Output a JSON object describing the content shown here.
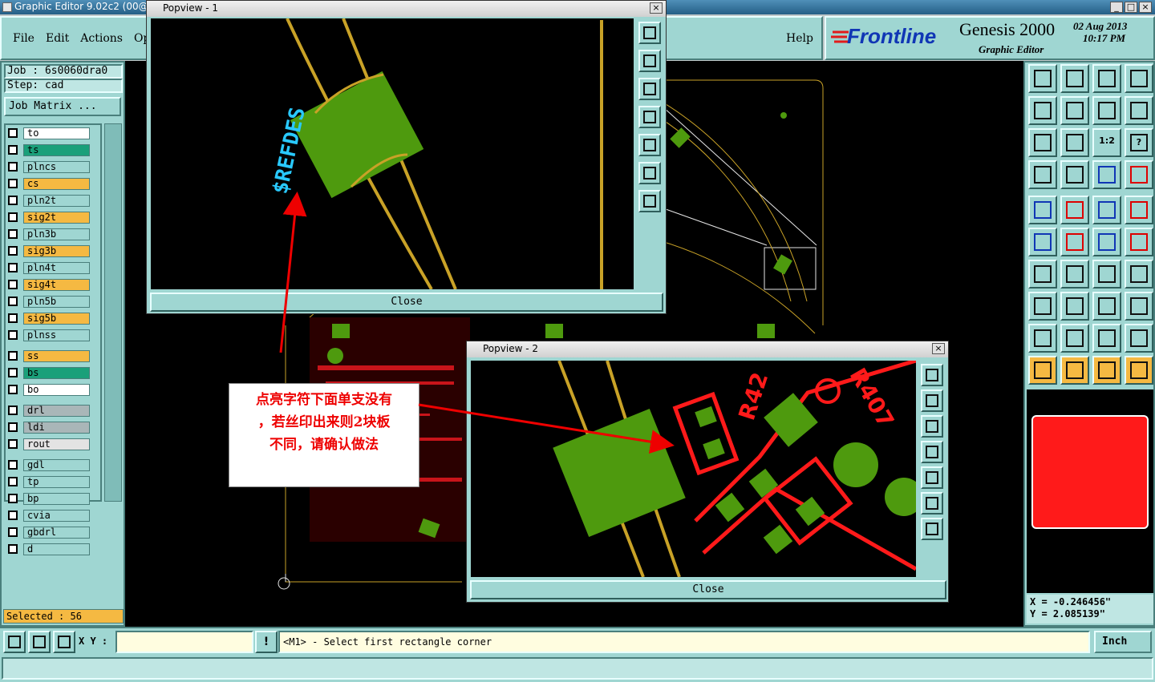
{
  "app": {
    "title": "Graphic Editor 9.02c2 (00@H)",
    "win_buttons": [
      "_",
      "□",
      "×"
    ]
  },
  "menu": [
    "File",
    "Edit",
    "Actions",
    "Op"
  ],
  "help": "Help",
  "brand": {
    "logo": "Frontline",
    "product": "Genesis 2000",
    "subtitle": "Graphic Editor",
    "date": "02 Aug 2013",
    "time": "10:17 PM"
  },
  "job": {
    "job": "Job : 6s0060dra0",
    "step": "Step: cad",
    "matrix_btn": "Job Matrix ..."
  },
  "layers": [
    {
      "name": "to",
      "color": "#ffffff"
    },
    {
      "name": "ts",
      "color": "#1aa07a"
    },
    {
      "name": "plncs",
      "color": "#9fd6d2"
    },
    {
      "name": "cs",
      "color": "#f5b942"
    },
    {
      "name": "pln2t",
      "color": "#9fd6d2"
    },
    {
      "name": "sig2t",
      "color": "#f5b942"
    },
    {
      "name": "pln3b",
      "color": "#9fd6d2"
    },
    {
      "name": "sig3b",
      "color": "#f5b942"
    },
    {
      "name": "pln4t",
      "color": "#9fd6d2"
    },
    {
      "name": "sig4t",
      "color": "#f5b942"
    },
    {
      "name": "pln5b",
      "color": "#9fd6d2"
    },
    {
      "name": "sig5b",
      "color": "#f5b942"
    },
    {
      "name": "plnss",
      "color": "#9fd6d2"
    },
    {
      "name": "ss",
      "color": "#f5b942"
    },
    {
      "name": "bs",
      "color": "#1aa07a"
    },
    {
      "name": "bo",
      "color": "#ffffff"
    },
    {
      "name": "drl",
      "color": "#a9b6b8"
    },
    {
      "name": "ldi",
      "color": "#a9b6b8"
    },
    {
      "name": "rout",
      "color": "#e3e3e3"
    },
    {
      "name": "gdl",
      "color": "#9fd6d2"
    },
    {
      "name": "tp",
      "color": "#9fd6d2"
    },
    {
      "name": "bp",
      "color": "#9fd6d2"
    },
    {
      "name": "cvia",
      "color": "#9fd6d2"
    },
    {
      "name": "gbdrl",
      "color": "#9fd6d2"
    },
    {
      "name": "d",
      "color": "#9fd6d2"
    }
  ],
  "selected": "Selected : 56",
  "popview1": {
    "title": "Popview - 1",
    "close": "Close",
    "refdes": "$REFDES"
  },
  "popview2": {
    "title": "Popview - 2",
    "close": "Close",
    "labels": [
      "R42",
      "R407"
    ]
  },
  "annotation": {
    "line1": "点亮字符下面单支没有",
    "line2": "，若丝印出来则2块板",
    "line3": "不同，请确认做法"
  },
  "coords": {
    "x": "X = -0.246456\"",
    "y": "Y = 2.085139\""
  },
  "bottom": {
    "xy_label": "X Y :",
    "xy_value": "",
    "prompt": "<M1> - Select first rectangle corner",
    "units": "Inch"
  },
  "toolbar_icons": [
    "home",
    "down",
    "house",
    "split",
    "left",
    "right",
    "swap",
    "s-curve",
    "fit",
    "center",
    "1:2",
    "help",
    "tools",
    "grid",
    "net-a",
    "net-b",
    "point",
    "poly",
    "ruler",
    "dot",
    "route",
    "cross",
    "via-red",
    "via-blue",
    "angle",
    "line",
    "arc",
    "ff",
    "seg",
    "wire",
    "meas",
    "copper",
    "tri",
    "A-shape",
    "A-fill",
    "A-line",
    "pointer",
    "pointer-sel",
    "pointer-alt",
    "route-sel"
  ],
  "colors": {
    "panel": "#9fd6d2",
    "canvas": "#000000",
    "silk": "#f5b942",
    "pad": "#4e9a0e",
    "trace": "#c9a227",
    "red": "#ff1a1a"
  }
}
